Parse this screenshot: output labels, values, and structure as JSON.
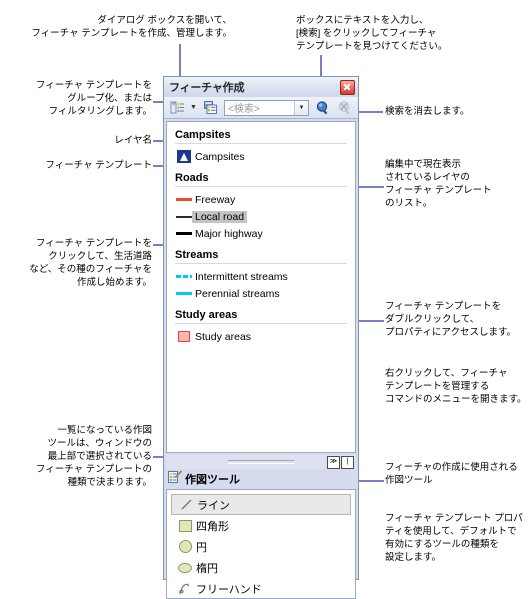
{
  "dialog": {
    "title": "フィーチャ作成",
    "close_label": "×",
    "toolbar": {
      "organize_icon": "organize-templates-icon",
      "dropdown_arrow": "▼",
      "filter_icon": "filter-templates-icon",
      "search_placeholder": "<検索>",
      "search_value": "",
      "search_dropdown_arrow": "▼",
      "search_icon": "magnifier-icon",
      "clear_search_icon": "clear-search-icon"
    },
    "groups": [
      {
        "name": "Campsites",
        "templates": [
          {
            "label": "Campsites",
            "symbol": "triangle",
            "color": "#1b3a8f",
            "selected": false
          }
        ]
      },
      {
        "name": "Roads",
        "templates": [
          {
            "label": "Freeway",
            "symbol": "line",
            "color": "#f04b32",
            "selected": false
          },
          {
            "label": "Local road",
            "symbol": "line",
            "color": "#2b2b2b",
            "selected": true
          },
          {
            "label": "Major highway",
            "symbol": "line",
            "color": "#000000",
            "selected": false
          }
        ]
      },
      {
        "name": "Streams",
        "templates": [
          {
            "label": "Intermittent streams",
            "symbol": "dashed-line",
            "color": "#00c8f0",
            "selected": false
          },
          {
            "label": "Perennial streams",
            "symbol": "line",
            "color": "#00c8f0",
            "selected": false
          }
        ]
      },
      {
        "name": "Study areas",
        "templates": [
          {
            "label": "Study areas",
            "symbol": "square",
            "color": "#ffb3b3",
            "selected": false
          }
        ]
      }
    ],
    "splitter": {
      "collapse_label": "≫",
      "expand_label": "|"
    },
    "tools": {
      "header": "作図ツール",
      "header_icon": "drawing-tools-icon",
      "items": [
        {
          "label": "ライン",
          "icon": "line-tool-icon",
          "selected": true
        },
        {
          "label": "四角形",
          "icon": "rectangle-tool-icon",
          "selected": false
        },
        {
          "label": "円",
          "icon": "circle-tool-icon",
          "selected": false
        },
        {
          "label": "楕円",
          "icon": "ellipse-tool-icon",
          "selected": false
        },
        {
          "label": "フリーハンド",
          "icon": "freehand-tool-icon",
          "selected": false
        }
      ]
    }
  },
  "callouts": {
    "open_dialog": "ダイアログ ボックスを開いて、\nフィーチャ テンプレートを作成、管理します。",
    "search_box": "ボックスにテキストを入力し、\n[検索] をクリックしてフィーチャ\nテンプレートを見つけてください。",
    "group_filter": "フィーチャ テンプレートを\nグループ化、または\nフィルタリングします。",
    "layer_name": "レイヤ名",
    "feature_template": "フィーチャ テンプレート",
    "click_template": "フィーチャ テンプレートを\nクリックして、生活道路\nなど、その種のフィーチャを\n作成し始めます。",
    "tool_list_depends": "一覧になっている作図\nツールは、ウィンドウの\n最上部で選択されている\nフィーチャ テンプレートの\n種類で決まります。",
    "clear_search": "検索を消去します。",
    "template_list": "編集中で現在表示\nされているレイヤの\nフィーチャ テンプレート\nのリスト。",
    "double_click": "フィーチャ テンプレートを\nダブルクリックして、\nプロパティにアクセスします。",
    "right_click": "右クリックして、フィーチャ\nテンプレートを管理する\nコマンドのメニューを開きます。",
    "drawing_tool": "フィーチャの作成に使用される\n作図ツール",
    "tool_properties": "フィーチャ テンプレート プロパ\nティを使用して、デフォルトで\n有効にするツールの種類を\n設定します。"
  },
  "colors": {
    "leader": "#7b7fc4",
    "dialog_bg": "#d6dced",
    "selection": "#c3c3c3"
  }
}
